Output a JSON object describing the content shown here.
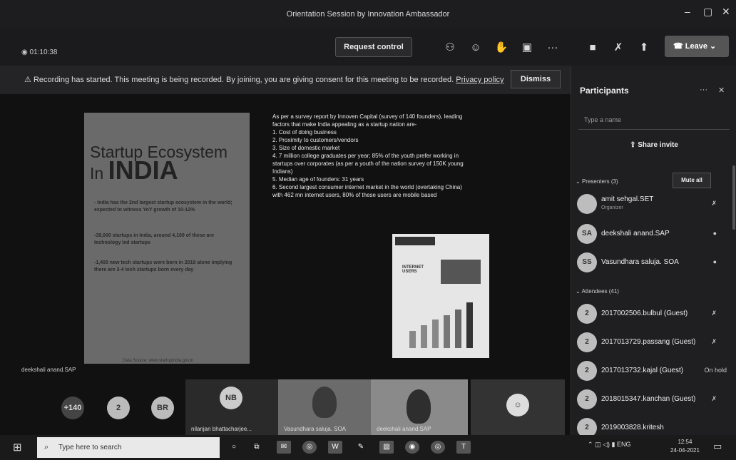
{
  "window": {
    "title": "Orientation Session by Innovation Ambassador"
  },
  "toolbar": {
    "timer": "01:10:38",
    "request_control": "Request control",
    "leave": "Leave"
  },
  "banner": {
    "text": "Recording has started. This meeting is being recorded. By joining, you are giving consent for this meeting to be recorded.",
    "link": "Privacy policy",
    "dismiss": "Dismiss"
  },
  "slide": {
    "title_line1": "Startup Ecosystem",
    "title_prefix": "In ",
    "title_big": "INDIA",
    "bullet1": "- India has the 2nd largest startup ecosystem in the world; expected to witness YoY growth of 10-12%",
    "bullet2": "-39,000 startups in India, around 4,100 of these are technology led startups",
    "bullet3": "-1,400 new tech startups were born in 2019 alone implying there are 3-4 tech startups born every day",
    "source": "Data Source: www.startupindia.gov.in",
    "right_intro": "As per a survey report by Innoven Capital (survey of 140 founders), leading factors that make India appealing as a startup nation are-",
    "right_items": [
      "1.  Cost of doing business",
      "2.  Proximity to customers/vendors",
      "3.  Size of domestic market",
      "4.  7 million college graduates per year; 85% of the youth prefer working in startups over corporates (as per a youth of the nation survey of 150K young Indians)",
      "5.  Median age of founders: 31 years",
      "6.  Second largest consumer internet market in the world (overtaking China) with 462 mn internet users, 80% of these users are mobile based"
    ],
    "infographic_label": "INTERNET USERS"
  },
  "stage": {
    "speaker_label": "deekshali anand.SAP"
  },
  "strip": {
    "more_count": "+140",
    "count2": "2",
    "br": "BR",
    "nb": "NB",
    "nb_name": "nilanjan bhattacharjee...",
    "video1_name": "Vasundhara saluja. SOA",
    "video2_name": "deekshali anand.SAP"
  },
  "participants": {
    "title": "Participants",
    "search_placeholder": "Type a name",
    "share_invite": "Share invite",
    "presenters_header": "Presenters (3)",
    "mute_all": "Mute all",
    "presenters": [
      {
        "initials": "",
        "name": "amit sehgal.SET",
        "sub": "Organizer"
      },
      {
        "initials": "SA",
        "name": "deekshali anand.SAP",
        "sub": ""
      },
      {
        "initials": "SS",
        "name": "Vasundhara saluja. SOA",
        "sub": ""
      }
    ],
    "attendees_header": "Attendees (41)",
    "attendees": [
      {
        "initials": "2",
        "name": "2017002506.bulbul (Guest)",
        "status": ""
      },
      {
        "initials": "2",
        "name": "2017013729.passang (Guest)",
        "status": ""
      },
      {
        "initials": "2",
        "name": "2017013732.kajal (Guest)",
        "status": "On hold"
      },
      {
        "initials": "2",
        "name": "2018015347.kanchan (Guest)",
        "status": ""
      },
      {
        "initials": "2",
        "name": "2019003828.kritesh",
        "status": ""
      }
    ]
  },
  "taskbar": {
    "search_placeholder": "Type here to search",
    "lang": "ENG",
    "time": "12:54",
    "date": "24-04-2021"
  }
}
